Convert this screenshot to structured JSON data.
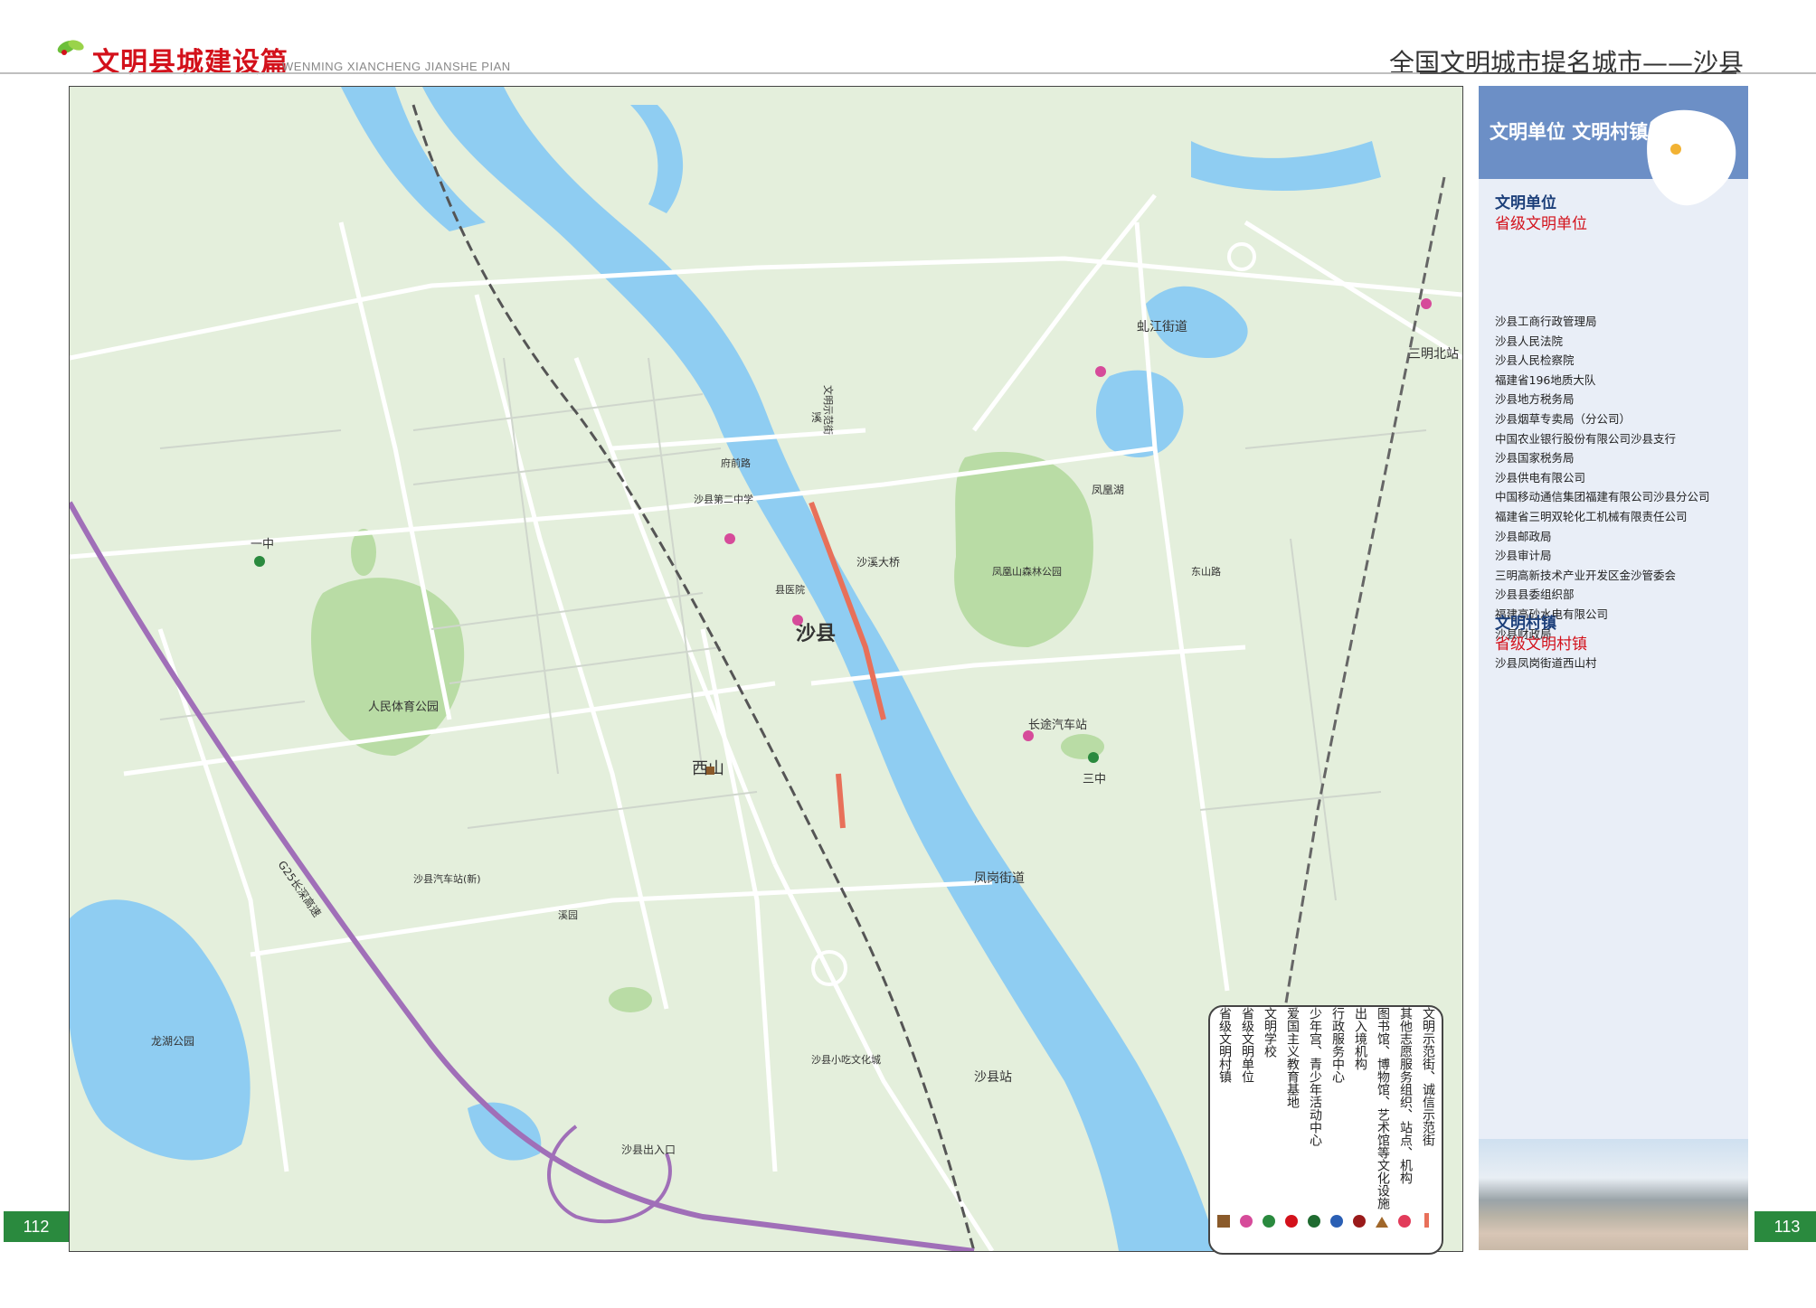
{
  "header": {
    "title": "文明县城建设篇",
    "pinyin": "WENMING XIANCHENG JIANSHE PIAN",
    "right_title": "全国文明城市提名城市——沙县"
  },
  "pages": {
    "left": "112",
    "right": "113"
  },
  "colors": {
    "brand_red": "#d3111b",
    "water": "#8fcdf2",
    "land": "#e4efdc",
    "green": "#2a8a3e",
    "panel_blue": "#6c8fc6",
    "highlight": "#e8705a"
  },
  "map_labels": {
    "county": "沙县",
    "west_hill": "西山",
    "park": "人民体育公园",
    "sanming_north": "三明北站",
    "shaxian_station": "沙县站",
    "changtai_station": "长途汽车站",
    "fengcun": "凤岗街道",
    "hongshan": "虬江街道",
    "phoenix_lake": "凤凰湖",
    "river": "溪",
    "expressway": "G25长深高速",
    "shaxian_exit": "沙县出入口",
    "longhu_park": "龙湖公园",
    "yizhong": "一中",
    "sanzhong": "三中",
    "civil_street": "文明示范街",
    "nanbei_bridge": "沙溪大桥",
    "school": "沙县第二中学",
    "hospital": "县医院",
    "xiyu": "溪园",
    "dongshan": "东山路",
    "gonghe": "府前路",
    "bus_station": "沙县汽车站(新)",
    "yuzhou": "沙县小吃文化城",
    "gongyuan": "凤凰山森林公园"
  },
  "legend": [
    {
      "label": "省级文明村镇",
      "icon": "square-brown-icon"
    },
    {
      "label": "省级文明单位",
      "icon": "circle-magenta-icon"
    },
    {
      "label": "文明学校",
      "icon": "circle-green-icon"
    },
    {
      "label": "爱国主义教育基地",
      "icon": "circle-red-icon"
    },
    {
      "label": "少年宫、青少年活动中心",
      "icon": "circle-darkgreen-icon"
    },
    {
      "label": "行政服务中心",
      "icon": "circle-blue-icon"
    },
    {
      "label": "出入境机构",
      "icon": "circle-darkred-icon"
    },
    {
      "label": "图书馆、博物馆、艺术馆等文化设施",
      "icon": "triangle-brown-icon"
    },
    {
      "label": "其他志愿服务组织、站点、机构",
      "icon": "heart-red-icon"
    },
    {
      "label": "文明示范街、诚信示范街",
      "icon": "bar-orange-icon"
    }
  ],
  "sidebar": {
    "head_title": "文明单位  文明村镇",
    "units_title": "文明单位",
    "units_sub": "省级文明单位",
    "units": [
      "沙县工商行政管理局",
      "沙县人民法院",
      "沙县人民检察院",
      "福建省196地质大队",
      "沙县地方税务局",
      "沙县烟草专卖局（分公司）",
      "中国农业银行股份有限公司沙县支行",
      "沙县国家税务局",
      "沙县供电有限公司",
      "中国移动通信集团福建有限公司沙县分公司",
      "福建省三明双轮化工机械有限责任公司",
      "沙县邮政局",
      "沙县审计局",
      "三明高新技术产业开发区金沙管委会",
      "沙县县委组织部",
      "福建高砂水电有限公司",
      "沙县财政局"
    ],
    "villages_title": "文明村镇",
    "villages_sub": "省级文明村镇",
    "villages": [
      "沙县凤岗街道西山村"
    ]
  }
}
